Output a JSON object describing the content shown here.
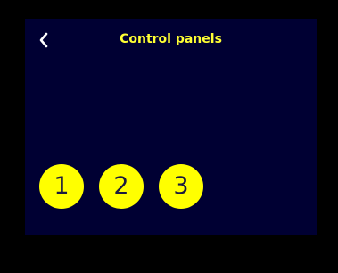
{
  "header": {
    "back_icon": "chevron-left-icon",
    "title": "Control panels"
  },
  "panels": [
    {
      "label": "1"
    },
    {
      "label": "2"
    },
    {
      "label": "3"
    }
  ],
  "colors": {
    "background": "#000033",
    "accent": "#ffff00",
    "title_text": "#ffff33",
    "button_text": "#1a1a40"
  }
}
